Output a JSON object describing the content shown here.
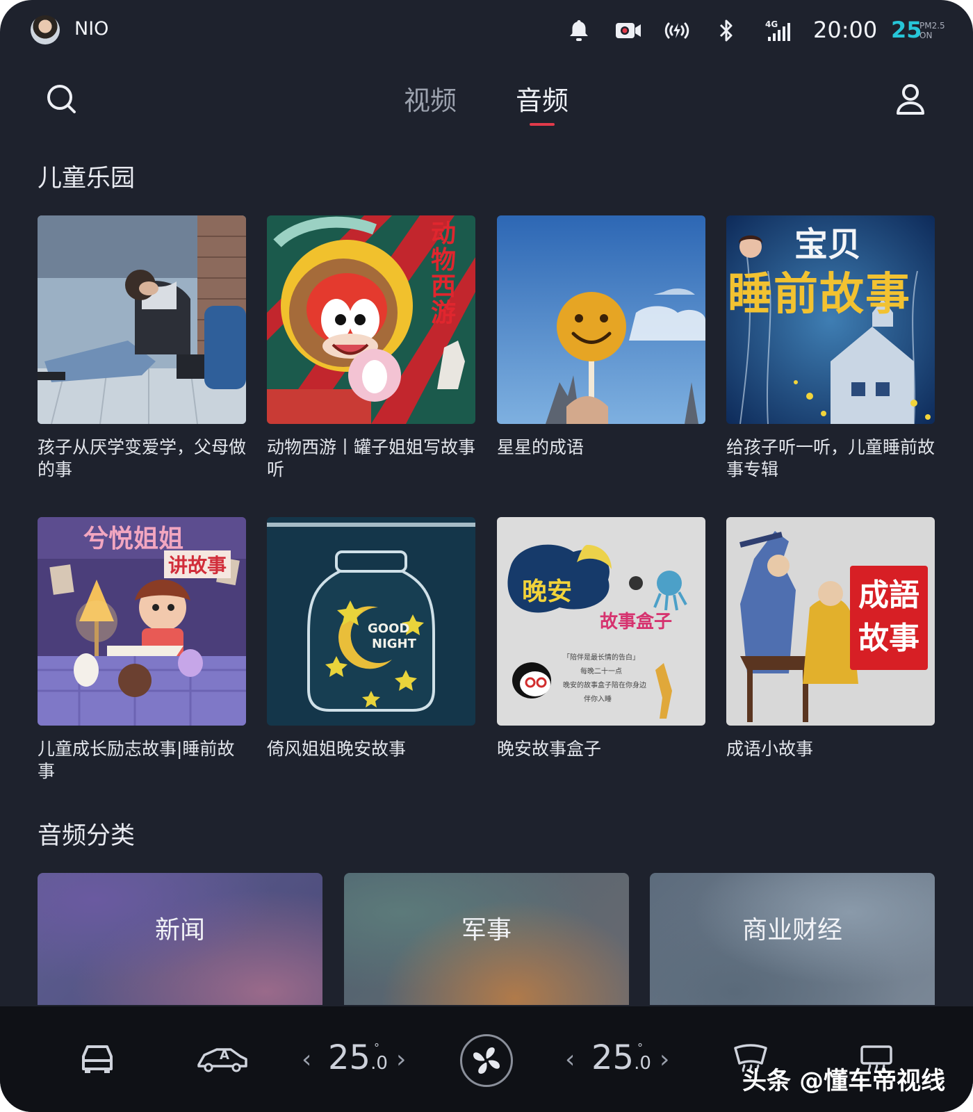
{
  "status_bar": {
    "user_name": "NIO",
    "time": "20:00",
    "aqi_value": "25",
    "aqi_label_top": "PM2.5",
    "aqi_label_bottom": "ON",
    "network": "4G",
    "icons": [
      "bell-icon",
      "camera-record-icon",
      "wireless-charging-icon",
      "bluetooth-icon",
      "signal-4g-icon"
    ]
  },
  "nav": {
    "tabs": [
      {
        "label": "视频",
        "active": false
      },
      {
        "label": "音频",
        "active": true
      }
    ],
    "accent_color": "#e23a4a"
  },
  "kids_section": {
    "title": "儿童乐园",
    "albums": [
      {
        "title": "孩子从厌学变爱学，父母做的事"
      },
      {
        "title": "动物西游丨罐子姐姐写故事听",
        "cover_text": "动物西游"
      },
      {
        "title": "星星的成语"
      },
      {
        "title": "给孩子听一听，儿童睡前故事专辑",
        "cover_text_top": "宝贝",
        "cover_text_main": "睡前故事"
      },
      {
        "title": "儿童成长励志故事|睡前故事",
        "cover_text_top": "兮悦姐姐",
        "cover_text_sub": "讲故事"
      },
      {
        "title": "倚风姐姐晚安故事",
        "cover_text_1": "GOOD",
        "cover_text_2": "NIGHT"
      },
      {
        "title": "晚安故事盒子",
        "cover_text_1": "晚安",
        "cover_text_2": "故事盒子"
      },
      {
        "title": "成语小故事",
        "cover_text_1": "成語",
        "cover_text_2": "故事"
      }
    ]
  },
  "audio_categories": {
    "title": "音频分类",
    "items": [
      {
        "label": "新闻"
      },
      {
        "label": "军事"
      },
      {
        "label": "商业财经"
      }
    ]
  },
  "dock": {
    "left_temp": "25",
    "left_temp_decimal": ".0",
    "right_temp": "25",
    "right_temp_decimal": ".0",
    "degree": "°",
    "arrow_left": "‹",
    "arrow_right": "›",
    "auto_label": "A",
    "icons": [
      "car-icon",
      "car-auto-icon",
      "fan-icon",
      "front-defrost-icon",
      "rear-defrost-icon"
    ]
  },
  "watermark": "头条 @懂车帝视线"
}
